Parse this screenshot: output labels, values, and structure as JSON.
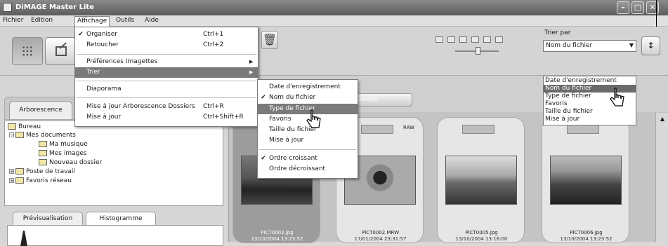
{
  "window": {
    "title": "DiMAGE Master Lite",
    "controls": [
      "–",
      "□",
      "✕"
    ]
  },
  "menubar": {
    "items": [
      "Fichier",
      "Edition",
      "Affichage",
      "Outils",
      "Aide"
    ]
  },
  "toolbar": {
    "sort_label": "Trier par",
    "sort_value": "Nom du fichier",
    "order_icon": "↕",
    "delete_icon": "trash-icon"
  },
  "affichage_menu": {
    "items": [
      {
        "label": "Organiser",
        "shortcut": "Ctrl+1",
        "checked": true
      },
      {
        "label": "Retoucher",
        "shortcut": "Ctrl+2",
        "checked": false
      },
      {
        "label": "Préférences Imagettes",
        "submenu": true
      },
      {
        "label": "Trier",
        "submenu": true,
        "highlighted": true
      },
      {
        "label": "Diaporama"
      },
      {
        "label": "Mise à jour Arborescence Dossiers",
        "shortcut": "Ctrl+R"
      },
      {
        "label": "Mise à jour",
        "shortcut": "Ctrl+Shift+R"
      }
    ]
  },
  "trier_submenu": {
    "items": [
      {
        "label": "Date d'enregistrement",
        "checked": false
      },
      {
        "label": "Nom du fichier",
        "checked": true
      },
      {
        "label": "Type de fichier",
        "checked": false,
        "highlighted": true
      },
      {
        "label": "Favoris",
        "checked": false
      },
      {
        "label": "Taille du fichier",
        "checked": false
      },
      {
        "label": "Mise à jour",
        "checked": false
      },
      {
        "label": "Ordre croissant",
        "checked": true
      },
      {
        "label": "Ordre décroissant",
        "checked": false
      }
    ]
  },
  "sort_listbox": {
    "items": [
      {
        "label": "Date d'enregistrement"
      },
      {
        "label": "Nom du fichier",
        "highlighted": true
      },
      {
        "label": "Type de fichier"
      },
      {
        "label": "Favoris"
      },
      {
        "label": "Taille du fichier"
      },
      {
        "label": "Mise à jour"
      }
    ]
  },
  "left_panel": {
    "tab_label": "Arborescence",
    "tree": [
      {
        "label": "Bureau"
      },
      {
        "label": "Mes documents"
      },
      {
        "label": "Ma musique"
      },
      {
        "label": "Mes images",
        "selected": true
      },
      {
        "label": "Nouveau dossier"
      },
      {
        "label": "Poste de travail"
      },
      {
        "label": "Favoris réseau"
      }
    ],
    "bottom_tabs": [
      "Prévisualisation",
      "Histogramme"
    ]
  },
  "right_panel": {
    "favorites_tab": "Favoris",
    "thumbnails": [
      {
        "file": "PICT0002.jpg",
        "date": "13/10/2004 13:23:52",
        "selected": true,
        "tag": ""
      },
      {
        "file": "PICT0002.MRW",
        "date": "17/01/2004 23:31:57",
        "selected": false,
        "tag": "RAW"
      },
      {
        "file": "PICT0005.jpg",
        "date": "13/10/2004 13:16:00",
        "selected": false,
        "tag": ""
      },
      {
        "file": "PICT0006.jpg",
        "date": "13/10/2004 13:23:52",
        "selected": false,
        "tag": ""
      }
    ]
  },
  "colors": {
    "highlight": "#7a7a7a",
    "background": "#d9d9d9"
  }
}
